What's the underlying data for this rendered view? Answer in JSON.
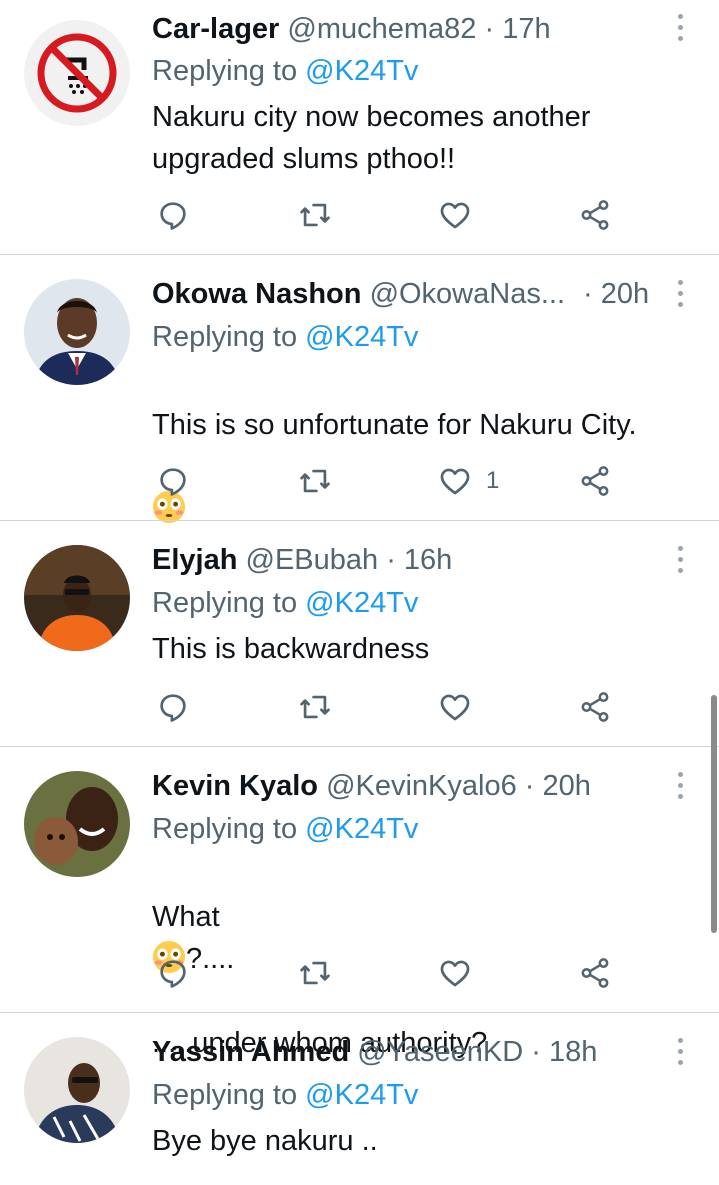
{
  "reply_prefix": "Replying to",
  "tweets": [
    {
      "name": "Car-lager",
      "handle": "@muchema82",
      "time": "· 17h",
      "replying_to": "@K24Tv",
      "text": "Nakuru city now becomes another upgraded slums pthoo!!",
      "likes": ""
    },
    {
      "name": "Okowa Nashon",
      "handle": "@OkowaNas...",
      "time": "· 20h",
      "replying_to": "@K24Tv",
      "text": "This is so unfortunate for Nakuru City.",
      "likes": "1"
    },
    {
      "name": "Elyjah",
      "handle": "@EBubah",
      "time": "· 16h",
      "replying_to": "@K24Tv",
      "text": "This is backwardness",
      "likes": ""
    },
    {
      "name": "Kevin Kyalo",
      "handle": "@KevinKyalo6",
      "time": "· 20h",
      "replying_to": "@K24Tv",
      "text_line1": "What",
      "text_line1_after": "?....",
      "text_line2": ".....under whom authority?",
      "likes": ""
    },
    {
      "name": "Yassin Ahmed",
      "handle": "@YaseenKD",
      "time": "· 18h",
      "replying_to": "@K24Tv",
      "text": "Bye bye nakuru ..",
      "likes": ""
    }
  ],
  "icons": {
    "reply": "reply-icon",
    "retweet": "retweet-icon",
    "like": "heart-icon",
    "share": "share-icon",
    "menu": "more-vertical-icon",
    "emoji": "flushed-face-emoji"
  },
  "colors": {
    "link": "#1d9bf0",
    "secondary": "#536471",
    "text": "#0f1419",
    "icon": "#536471"
  }
}
